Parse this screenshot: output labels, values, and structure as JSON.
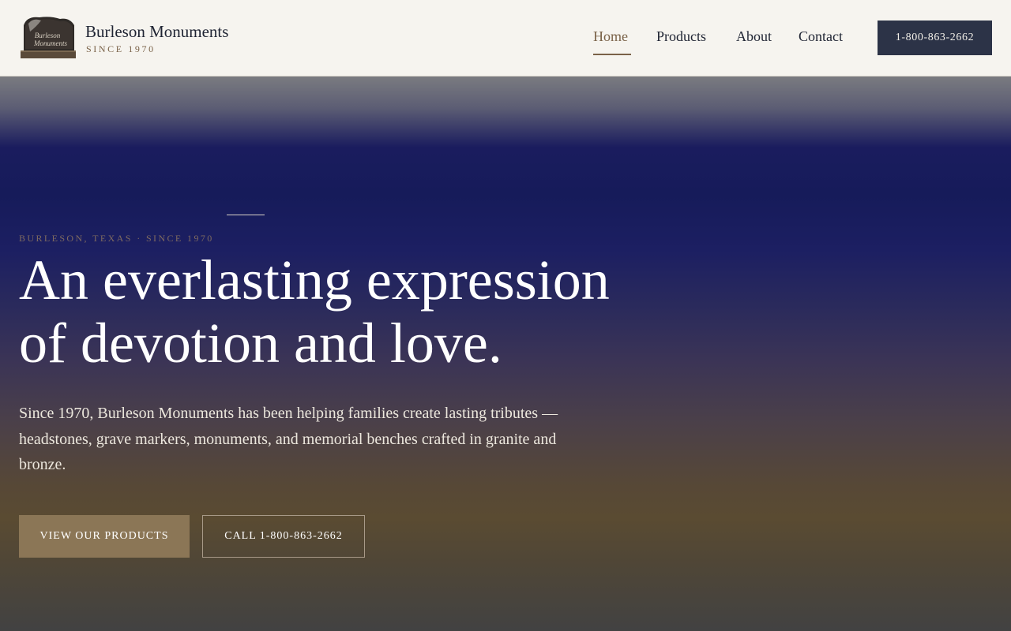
{
  "header": {
    "brand_name": "Burleson Monuments",
    "brand_tagline": "SINCE 1970",
    "logo_icon": "headstone-logo-icon",
    "nav": [
      {
        "label": "Home",
        "active": true
      },
      {
        "label": "Products",
        "active": false
      },
      {
        "label": "About",
        "active": false
      },
      {
        "label": "Contact",
        "active": false
      }
    ],
    "phone_button": "1-800-863-2662"
  },
  "hero": {
    "eyebrow": "BURLESON, TEXAS · SINCE 1970",
    "title_line1": "An everlasting expression",
    "title_line2": "of devotion and love.",
    "body": "Since 1970, Burleson Monuments has been helping families create lasting tributes — headstones, grave markers, monuments, and memorial benches crafted in granite and bronze.",
    "primary_button": "VIEW OUR PRODUCTS",
    "secondary_button": "CALL 1-800-863-2662"
  },
  "colors": {
    "accent_brown": "#7a6248",
    "navy_button": "#2c3347",
    "primary_button": "#8b7656",
    "header_bg": "#f6f4ef"
  }
}
